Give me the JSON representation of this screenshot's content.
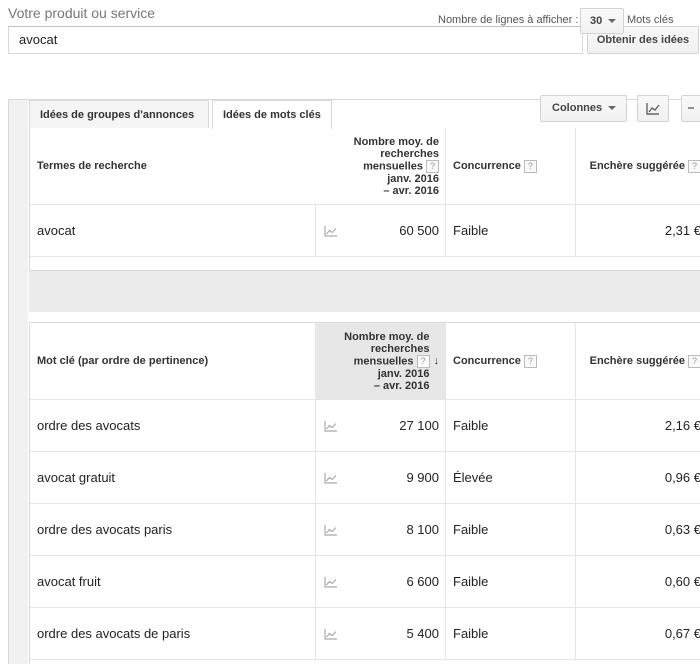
{
  "search": {
    "label": "Votre produit ou service",
    "value": "avocat",
    "button": "Obtenir des idées"
  },
  "tabs": {
    "groups": "Idées de groupes d'annonces",
    "keywords": "Idées de mots clés"
  },
  "toolbar": {
    "columns": "Colonnes"
  },
  "search_terms_table": {
    "header": {
      "term": "Termes de recherche",
      "volume_lines": [
        "Nombre moy. de",
        "recherches",
        "mensuelles",
        "janv. 2016",
        "– avr. 2016"
      ],
      "competition": "Concurrence",
      "bid": "Enchère suggérée",
      "help": "?"
    },
    "rows": [
      {
        "term": "avocat",
        "volume": "60 500",
        "competition": "Faible",
        "bid": "2,31 €"
      }
    ]
  },
  "pager": {
    "label": "Nombre de lignes à afficher :",
    "value": "30",
    "suffix": "Mots clés"
  },
  "keyword_table": {
    "header": {
      "term": "Mot clé (par ordre de pertinence)",
      "volume_lines": [
        "Nombre moy. de",
        "recherches",
        "mensuelles",
        "janv. 2016",
        "– avr. 2016"
      ],
      "competition": "Concurrence",
      "bid": "Enchère suggérée",
      "help": "?",
      "sort": "↓"
    },
    "rows": [
      {
        "term": "ordre des avocats",
        "volume": "27 100",
        "competition": "Faible",
        "bid": "2,16 €"
      },
      {
        "term": "avocat gratuit",
        "volume": "9 900",
        "competition": "Élevée",
        "bid": "0,96 €"
      },
      {
        "term": "ordre des avocats paris",
        "volume": "8 100",
        "competition": "Faible",
        "bid": "0,63 €"
      },
      {
        "term": "avocat fruit",
        "volume": "6 600",
        "competition": "Faible",
        "bid": "0,60 €"
      },
      {
        "term": "ordre des avocats de paris",
        "volume": "5 400",
        "competition": "Faible",
        "bid": "0,67 €"
      }
    ]
  }
}
